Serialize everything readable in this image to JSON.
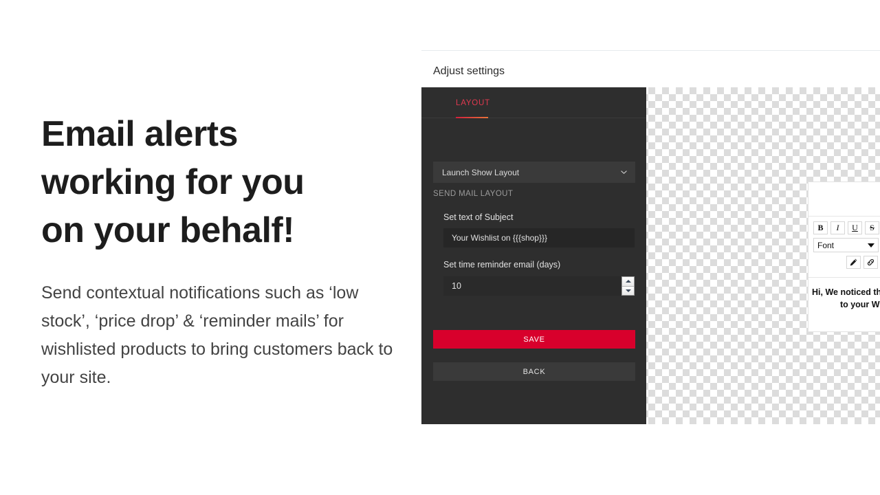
{
  "promo": {
    "heading_lines": [
      "Email alerts",
      "working for you",
      "on your behalf!"
    ],
    "body": "Send contextual notifications such as ‘low stock’, ‘price drop’ & ‘reminder mails’ for wishlisted products to bring customers back to your site."
  },
  "app": {
    "title": "Adjust settings",
    "accent_red": "#d8002c",
    "tab_accent": "#e0394f",
    "panel_bg": "#2e2e2e"
  },
  "panel": {
    "tabs": [
      {
        "label": "LAYOUT",
        "active": true
      }
    ],
    "layout_select": {
      "value": "Launch Show Layout",
      "icon": "chevron-down-icon"
    },
    "section_label": "SEND MAIL LAYOUT",
    "fields": [
      {
        "label": "Set text of Subject",
        "value": "Your Wishlist on {{{shop}}}",
        "type": "text"
      },
      {
        "label": "Set time reminder email (days)",
        "value": "10",
        "type": "number"
      }
    ],
    "buttons": {
      "save": "SAVE",
      "back": "BACK"
    }
  },
  "editor": {
    "toolbar": {
      "bold": "B",
      "italic": "I",
      "underline": "U",
      "strikethrough": "S",
      "font_label": "Font",
      "pen_icon": "pen-icon",
      "link_icon": "link-icon"
    },
    "content_lines": [
      "Hi, We noticed tha",
      "to your Wishlist."
    ]
  }
}
